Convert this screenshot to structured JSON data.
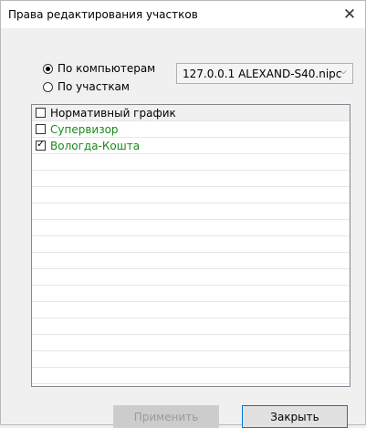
{
  "window": {
    "title": "Права редактирования участков",
    "close_label": "✕"
  },
  "mode": {
    "options": [
      {
        "label": "По компьютерам",
        "selected": true
      },
      {
        "label": "По участкам",
        "selected": false
      }
    ]
  },
  "computer_select": {
    "value": "127.0.0.1 ALEXAND-S40.nipc",
    "arrow": "⌵"
  },
  "list": {
    "items": [
      {
        "label": "Нормативный график",
        "checked": false,
        "color": "#000000"
      },
      {
        "label": "Супервизор",
        "checked": false,
        "color": "#1a8a1a"
      },
      {
        "label": "Вологда-Кошта",
        "checked": true,
        "color": "#1a8a1a"
      }
    ],
    "check_mark": "✓"
  },
  "buttons": {
    "apply_label": "Применить",
    "close_label": "Закрыть"
  }
}
